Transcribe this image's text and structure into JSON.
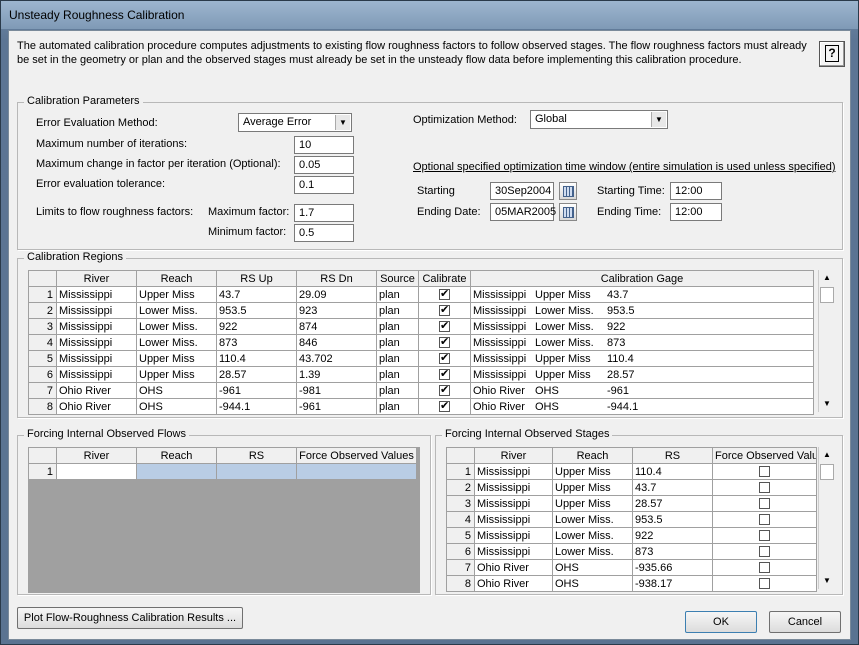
{
  "window": {
    "title": "Unsteady Roughness Calibration"
  },
  "description": "The automated calibration procedure computes adjustments to existing flow roughness factors to follow observed stages. The flow roughness factors must already be set in the geometry or plan and the observed stages must already be set in the unsteady flow data before implementing this calibration procedure.",
  "help_label": "?",
  "params": {
    "legend": "Calibration Parameters",
    "error_eval_label": "Error Evaluation Method:",
    "error_eval_value": "Average Error",
    "max_iter_label": "Maximum number of iterations:",
    "max_iter_value": "10",
    "max_change_label": "Maximum change in factor per iteration (Optional):",
    "max_change_value": "0.05",
    "tolerance_label": "Error evaluation tolerance:",
    "tolerance_value": "0.1",
    "limits_label": "Limits to flow roughness factors:",
    "max_factor_label": "Maximum factor:",
    "max_factor_value": "1.7",
    "min_factor_label": "Minimum factor:",
    "min_factor_value": "0.5",
    "opt_method_label": "Optimization Method:",
    "opt_method_value": "Global",
    "time_window_label": "Optional specified optimization time window (entire simulation is used unless specified)",
    "starting_date_label": "Starting",
    "starting_date_value": "30Sep2004",
    "ending_date_label": "Ending Date:",
    "ending_date_value": "05MAR2005",
    "starting_time_label": "Starting Time:",
    "starting_time_value": "12:00",
    "ending_time_label": "Ending Time:",
    "ending_time_value": "12:00"
  },
  "regions": {
    "legend": "Calibration Regions",
    "headers": [
      "River",
      "Reach",
      "RS Up",
      "RS Dn",
      "Source",
      "Calibrate",
      "Calibration Gage"
    ],
    "rows": [
      {
        "n": "1",
        "river": "Mississippi",
        "reach": "Upper Miss",
        "rs_up": "43.7",
        "rs_dn": "29.09",
        "source": "plan",
        "g_river": "Mississippi",
        "g_reach": "Upper Miss",
        "g_rs": "43.7"
      },
      {
        "n": "2",
        "river": "Mississippi",
        "reach": "Lower Miss.",
        "rs_up": "953.5",
        "rs_dn": "923",
        "source": "plan",
        "g_river": "Mississippi",
        "g_reach": "Lower Miss.",
        "g_rs": "953.5"
      },
      {
        "n": "3",
        "river": "Mississippi",
        "reach": "Lower Miss.",
        "rs_up": "922",
        "rs_dn": "874",
        "source": "plan",
        "g_river": "Mississippi",
        "g_reach": "Lower Miss.",
        "g_rs": "922"
      },
      {
        "n": "4",
        "river": "Mississippi",
        "reach": "Lower Miss.",
        "rs_up": "873",
        "rs_dn": "846",
        "source": "plan",
        "g_river": "Mississippi",
        "g_reach": "Lower Miss.",
        "g_rs": "873"
      },
      {
        "n": "5",
        "river": "Mississippi",
        "reach": "Upper Miss",
        "rs_up": "110.4",
        "rs_dn": "43.702",
        "source": "plan",
        "g_river": "Mississippi",
        "g_reach": "Upper Miss",
        "g_rs": "110.4"
      },
      {
        "n": "6",
        "river": "Mississippi",
        "reach": "Upper Miss",
        "rs_up": "28.57",
        "rs_dn": "1.39",
        "source": "plan",
        "g_river": "Mississippi",
        "g_reach": "Upper Miss",
        "g_rs": "28.57"
      },
      {
        "n": "7",
        "river": "Ohio River",
        "reach": "OHS",
        "rs_up": "-961",
        "rs_dn": "-981",
        "source": "plan",
        "g_river": "Ohio River",
        "g_reach": "OHS",
        "g_rs": "-961"
      },
      {
        "n": "8",
        "river": "Ohio River",
        "reach": "OHS",
        "rs_up": "-944.1",
        "rs_dn": "-961",
        "source": "plan",
        "g_river": "Ohio River",
        "g_reach": "OHS",
        "g_rs": "-944.1"
      }
    ]
  },
  "flows": {
    "legend": "Forcing Internal Observed Flows",
    "headers": [
      "River",
      "Reach",
      "RS",
      "Force Observed Values"
    ],
    "rows": [
      {
        "n": "1"
      }
    ]
  },
  "stages": {
    "legend": "Forcing Internal Observed Stages",
    "headers": [
      "River",
      "Reach",
      "RS",
      "Force Observed Values"
    ],
    "rows": [
      {
        "n": "1",
        "river": "Mississippi",
        "reach": "Upper Miss",
        "rs": "110.4"
      },
      {
        "n": "2",
        "river": "Mississippi",
        "reach": "Upper Miss",
        "rs": "43.7"
      },
      {
        "n": "3",
        "river": "Mississippi",
        "reach": "Upper Miss",
        "rs": "28.57"
      },
      {
        "n": "4",
        "river": "Mississippi",
        "reach": "Lower Miss.",
        "rs": "953.5"
      },
      {
        "n": "5",
        "river": "Mississippi",
        "reach": "Lower Miss.",
        "rs": "922"
      },
      {
        "n": "6",
        "river": "Mississippi",
        "reach": "Lower Miss.",
        "rs": "873"
      },
      {
        "n": "7",
        "river": "Ohio River",
        "reach": "OHS",
        "rs": "-935.66"
      },
      {
        "n": "8",
        "river": "Ohio River",
        "reach": "OHS",
        "rs": "-938.17"
      }
    ]
  },
  "buttons": {
    "plot": "Plot Flow-Roughness Calibration Results ...",
    "ok": "OK",
    "cancel": "Cancel"
  }
}
